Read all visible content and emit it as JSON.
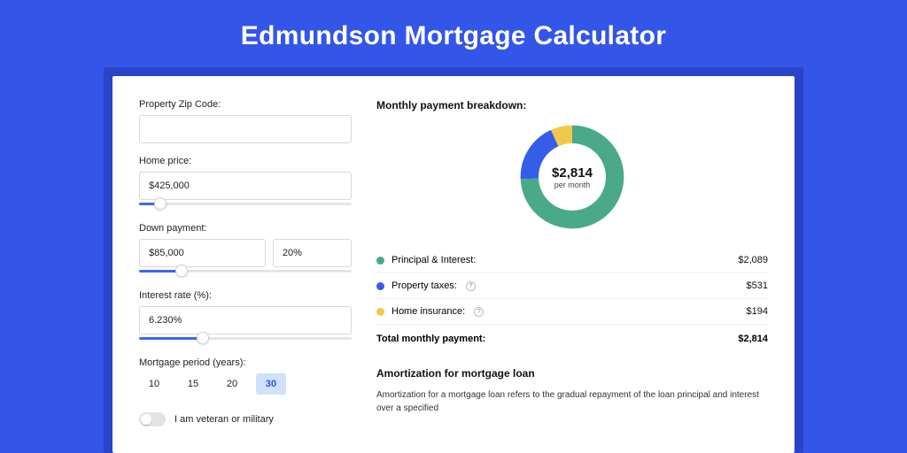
{
  "title": "Edmundson Mortgage Calculator",
  "form": {
    "zip_label": "Property Zip Code:",
    "zip_value": "",
    "home_price_label": "Home price:",
    "home_price_value": "$425,000",
    "home_price_slider_pct": 10,
    "down_payment_label": "Down payment:",
    "down_payment_value": "$85,000",
    "down_payment_pct_value": "20%",
    "down_payment_slider_pct": 20,
    "rate_label": "Interest rate (%):",
    "rate_value": "6.230%",
    "rate_slider_pct": 30,
    "period_label": "Mortgage period (years):",
    "periods": [
      "10",
      "15",
      "20",
      "30"
    ],
    "period_active_index": 3,
    "veteran_label": "I am veteran or military",
    "veteran_on": false
  },
  "breakdown": {
    "title": "Monthly payment breakdown:",
    "donut_amount": "$2,814",
    "donut_sub": "per month",
    "items": [
      {
        "label": "Principal & Interest:",
        "value": "$2,089",
        "num": 2089,
        "color": "green",
        "info": false
      },
      {
        "label": "Property taxes:",
        "value": "$531",
        "num": 531,
        "color": "blue",
        "info": true
      },
      {
        "label": "Home insurance:",
        "value": "$194",
        "num": 194,
        "color": "yellow",
        "info": true
      }
    ],
    "total_label": "Total monthly payment:",
    "total_value": "$2,814"
  },
  "amort": {
    "title": "Amortization for mortgage loan",
    "body": "Amortization for a mortgage loan refers to the gradual repayment of the loan principal and interest over a specified"
  },
  "chart_data": {
    "type": "pie",
    "title": "Monthly payment breakdown",
    "categories": [
      "Principal & Interest",
      "Property taxes",
      "Home insurance"
    ],
    "values": [
      2089,
      531,
      194
    ],
    "colors": [
      "#4aa989",
      "#355de8",
      "#f2c84b"
    ],
    "total": 2814,
    "unit": "USD per month"
  }
}
